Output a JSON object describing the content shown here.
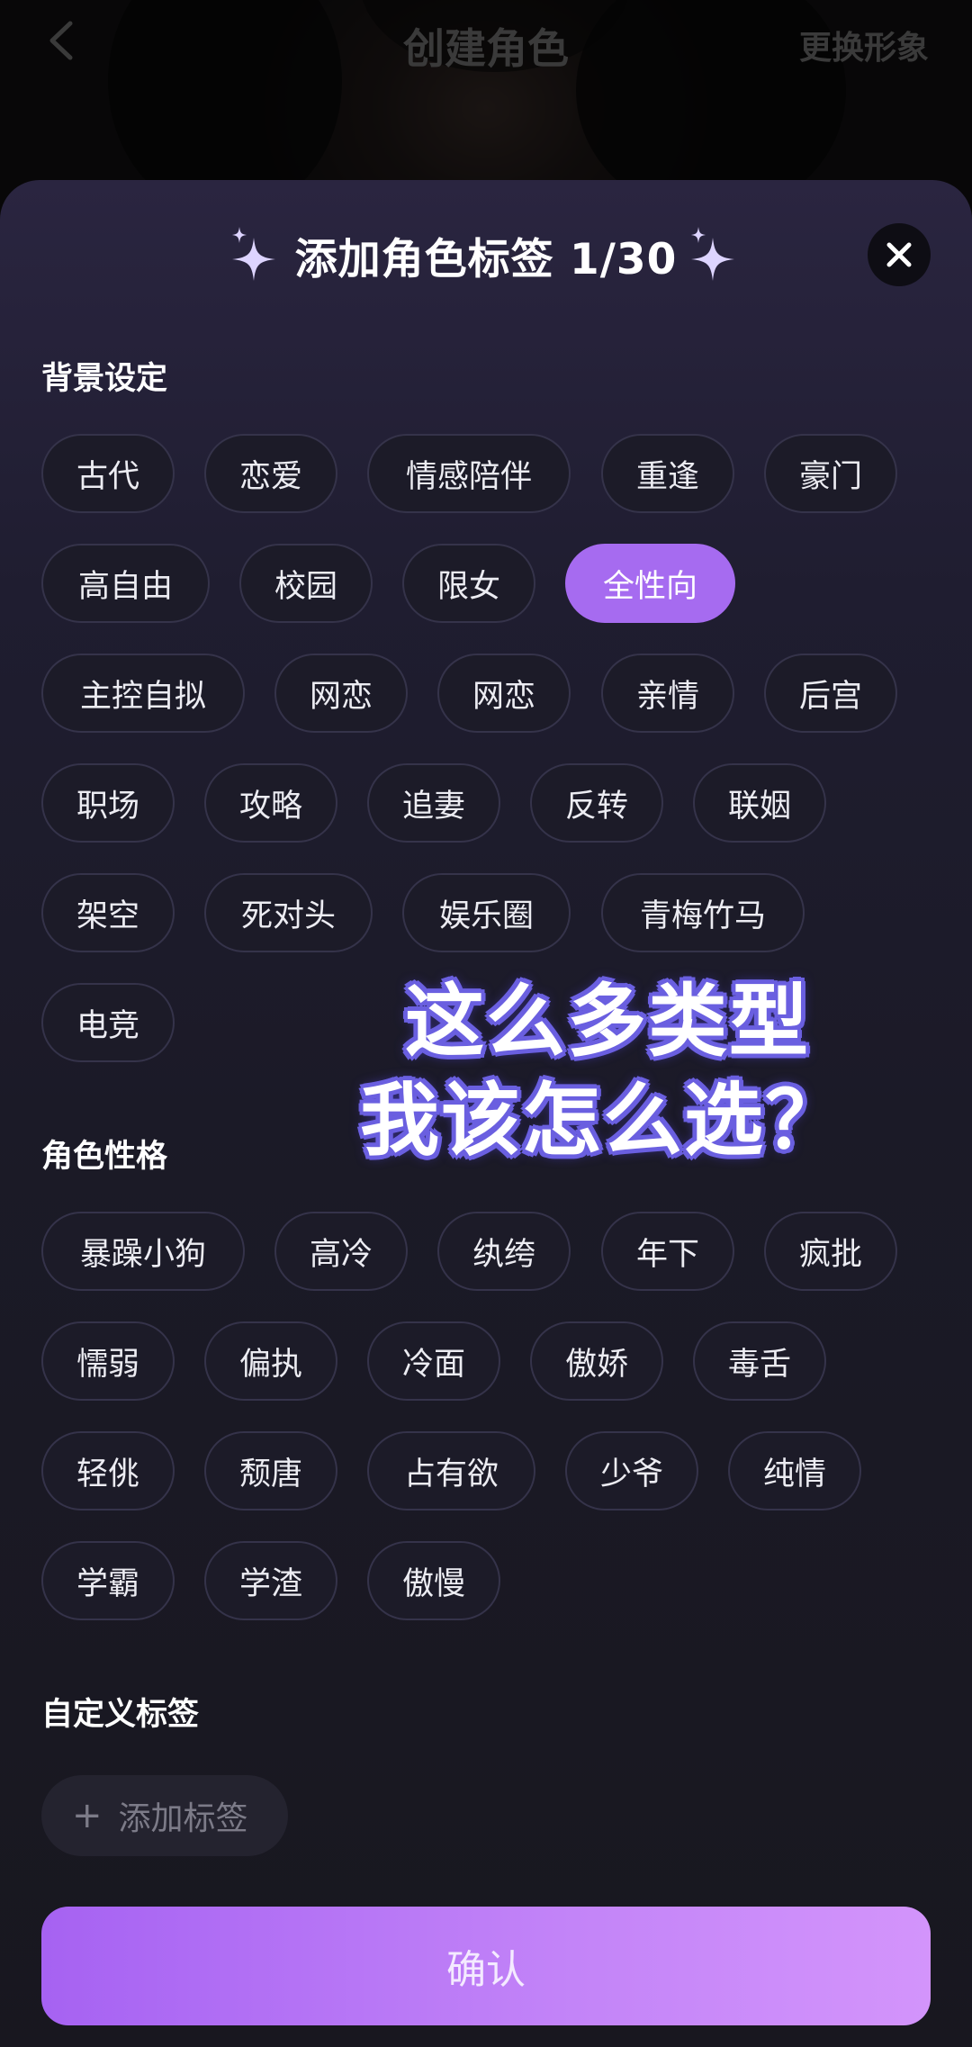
{
  "header": {
    "title": "创建角色",
    "action": "更换形象"
  },
  "sheet": {
    "title": "添加角色标签 1/30"
  },
  "sections": {
    "background": {
      "label": "背景设定",
      "tags": [
        "古代",
        "恋爱",
        "情感陪伴",
        "重逢",
        "豪门",
        "高自由",
        "校园",
        "限女",
        "全性向",
        "主控自拟",
        "网恋",
        "网恋",
        "亲情",
        "后宫",
        "职场",
        "攻略",
        "追妻",
        "反转",
        "联姻",
        "架空",
        "死对头",
        "娱乐圈",
        "青梅竹马",
        "电竞"
      ],
      "selected_index": 8
    },
    "personality": {
      "label": "角色性格",
      "tags": [
        "暴躁小狗",
        "高冷",
        "纨绔",
        "年下",
        "疯批",
        "懦弱",
        "偏执",
        "冷面",
        "傲娇",
        "毒舌",
        "轻佻",
        "颓唐",
        "占有欲",
        "少爷",
        "纯情",
        "学霸",
        "学渣",
        "傲慢"
      ]
    },
    "custom": {
      "label": "自定义标签",
      "add_label": "添加标签"
    }
  },
  "confirm_label": "确认",
  "overlay_caption": {
    "line1": "这么多类型",
    "line2": "我该怎么选？"
  },
  "colors": {
    "accent": "#a66bf0",
    "chip_border": "#35334a",
    "caption_outline": "#6a5fe0"
  },
  "icons": {
    "back": "chevron-left-icon",
    "close": "close-icon",
    "sparkle": "sparkle-icon",
    "plus": "plus-icon"
  }
}
